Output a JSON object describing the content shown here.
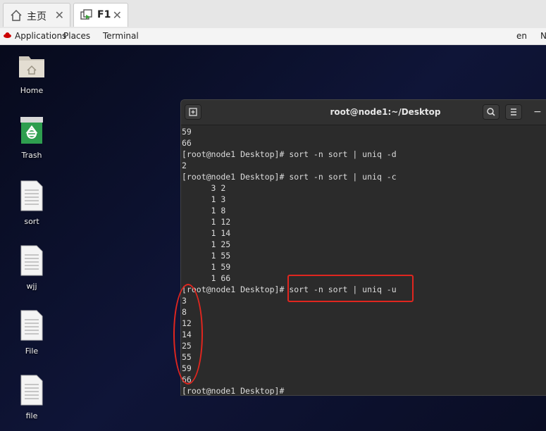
{
  "tabs": [
    {
      "label": "主页",
      "icon": "home-icon",
      "active": false
    },
    {
      "label": "F1",
      "icon": "vm-console-icon",
      "active": true
    }
  ],
  "topbar": {
    "applications": "Applications",
    "places": "Places",
    "terminal": "Terminal",
    "lang": "en",
    "edge": "N"
  },
  "desktop_icons": [
    {
      "label": "Home",
      "icon": "home-folder-icon"
    },
    {
      "label": "Trash",
      "icon": "trash-icon"
    },
    {
      "label": "sort",
      "icon": "text-file-icon"
    },
    {
      "label": "wjj",
      "icon": "text-file-icon"
    },
    {
      "label": "File",
      "icon": "text-file-icon"
    },
    {
      "label": "file",
      "icon": "text-file-icon"
    }
  ],
  "terminal": {
    "title": "root@node1:~/Desktop",
    "lines": [
      "59",
      "66",
      "[root@node1 Desktop]# sort -n sort | uniq -d",
      "2",
      "[root@node1 Desktop]# sort -n sort | uniq -c",
      "      3 2",
      "      1 3",
      "      1 8",
      "      1 12",
      "      1 14",
      "      1 25",
      "      1 55",
      "      1 59",
      "      1 66",
      "[root@node1 Desktop]# sort -n sort | uniq -u",
      "3",
      "8",
      "12",
      "14",
      "25",
      "55",
      "59",
      "66",
      "[root@node1 Desktop]#"
    ]
  },
  "colors": {
    "annotation": "#e0261f",
    "terminal_bg": "#2b2b2b"
  }
}
